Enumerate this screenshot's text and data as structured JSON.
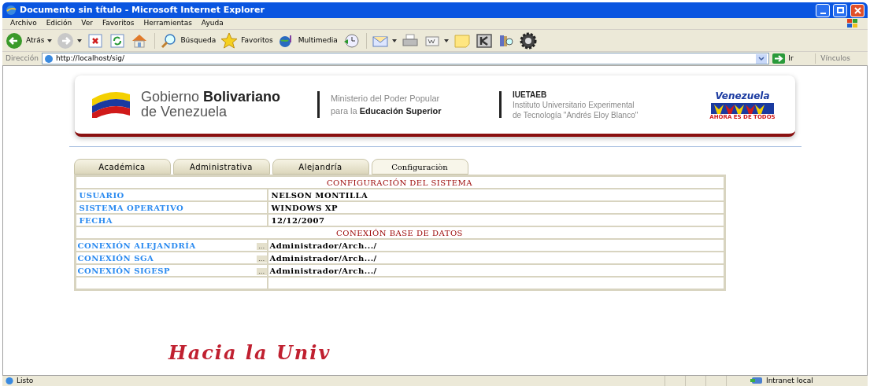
{
  "window": {
    "title": "Documento sin título - Microsoft Internet Explorer"
  },
  "menu": [
    "Archivo",
    "Edición",
    "Ver",
    "Favoritos",
    "Herramientas",
    "Ayuda"
  ],
  "toolbar": [
    {
      "kind": "back",
      "label": "Atrás"
    },
    {
      "kind": "forward"
    },
    {
      "kind": "stop"
    },
    {
      "kind": "refresh"
    },
    {
      "kind": "home"
    },
    {
      "kind": "search",
      "label": "Búsqueda"
    },
    {
      "kind": "star",
      "label": "Favoritos"
    },
    {
      "kind": "media",
      "label": "Multimedia"
    },
    {
      "kind": "history"
    },
    {
      "kind": "mail"
    },
    {
      "kind": "print"
    },
    {
      "kind": "word"
    },
    {
      "kind": "note"
    },
    {
      "kind": "k"
    },
    {
      "kind": "research"
    },
    {
      "kind": "gear"
    }
  ],
  "address": {
    "label": "Dirección",
    "value": "http://localhost/sig/",
    "go": "Ir",
    "links": "Vínculos"
  },
  "banner": {
    "gov_line1_a": "Gobierno ",
    "gov_line1_b": "Bolivariano",
    "gov_line2": "de Venezuela",
    "min_line1": "Ministerio del Poder Popular",
    "min_line2_a": "para la ",
    "min_line2_b": "Educación Superior",
    "inst_title": "IUETAEB",
    "inst_line1": "Instituto Universitario Experimental",
    "inst_line2": "de Tecnología \"Andrés Eloy Blanco\"",
    "vzla": "Venezuela",
    "vzla_sub": "AHORA ES DE TODOS"
  },
  "tabs": [
    {
      "label": "Académica",
      "selected": false
    },
    {
      "label": "Administrativa",
      "selected": false
    },
    {
      "label": "Alejandría",
      "selected": false
    },
    {
      "label": "Configuraciòn",
      "selected": true
    }
  ],
  "table": {
    "rows": [
      {
        "kind": "header",
        "text": "CONFIGURACIÓN DEL SISTEMA"
      },
      {
        "kind": "field",
        "label": "USUARIO",
        "value": "NELSON MONTILLA"
      },
      {
        "kind": "field",
        "label": "SISTEMA OPERATIVO",
        "value": "WINDOWS XP"
      },
      {
        "kind": "field",
        "label": "FECHA",
        "value": "12/12/2007"
      },
      {
        "kind": "header",
        "text": "CONEXIÓN BASE DE DATOS"
      },
      {
        "kind": "connection",
        "label": "CONEXIÓN ALEJANDRÍA",
        "button": "...",
        "value": "Administrador/Arch.../"
      },
      {
        "kind": "connection",
        "label": "CONEXIÓN SGA",
        "button": "...",
        "value": "Administrador/Arch.../"
      },
      {
        "kind": "connection",
        "label": "CONEXIÓN SIGESP",
        "button": "...",
        "value": "Administrador/Arch.../"
      },
      {
        "kind": "empty"
      }
    ]
  },
  "footer_logo": "Hacia la Univ",
  "status_bar": {
    "text": "Listo",
    "zone": "Intranet local"
  }
}
